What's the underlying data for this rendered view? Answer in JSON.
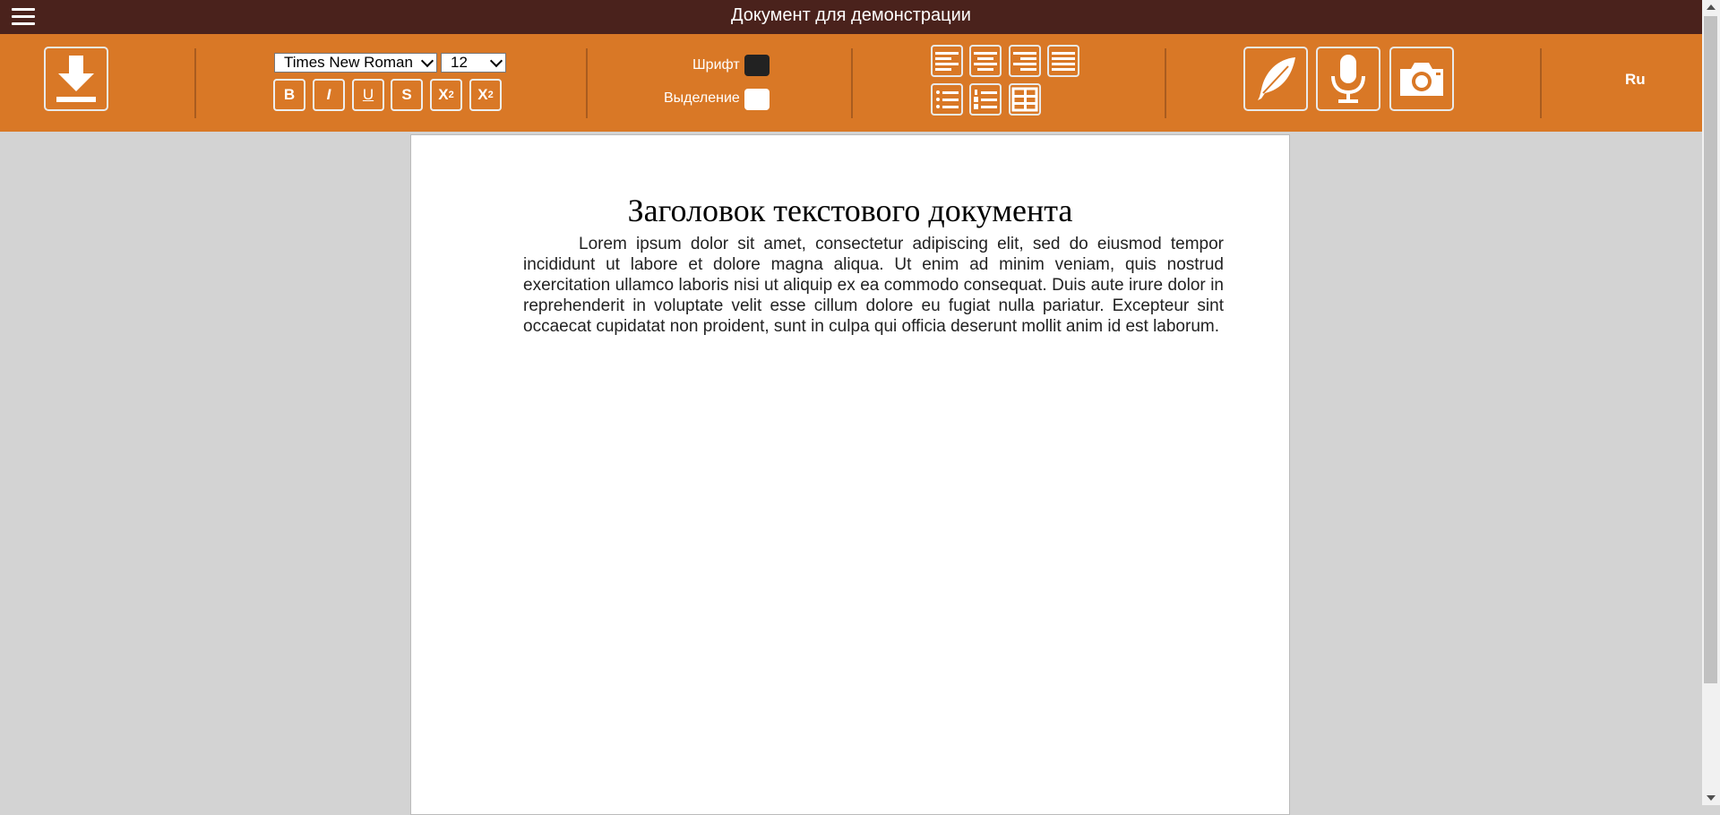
{
  "window": {
    "title": "Документ для демонстрации"
  },
  "toolbar": {
    "font_family": "Times New Roman",
    "font_size": "12",
    "font_color_label": "Шрифт",
    "highlight_label": "Выделение",
    "font_color": "#222222",
    "highlight_color": "#ffffff",
    "bold_label": "B",
    "italic_label": "I",
    "underline_label": "U",
    "strike_label": "S",
    "subscript_label": "X",
    "subscript_mark": "2",
    "superscript_label": "X",
    "superscript_mark": "2",
    "language": "Ru"
  },
  "icons": {
    "menu": "hamburger-icon",
    "download": "download-icon",
    "align_left": "align-left-icon",
    "align_center": "align-center-icon",
    "align_right": "align-right-icon",
    "align_justify": "align-justify-icon",
    "bullet_list": "bullet-list-icon",
    "numbered_list": "numbered-list-icon",
    "table": "table-icon",
    "handwriting": "feather-icon",
    "voice": "microphone-icon",
    "camera": "camera-icon"
  },
  "colors": {
    "titlebar": "#4a221c",
    "toolbar": "#d97826",
    "workspace": "#d3d3d3"
  },
  "document": {
    "heading": "Заголовок текстового документа",
    "paragraph": "Lorem ipsum dolor sit amet, consectetur adipiscing elit, sed do eiusmod tempor incididunt ut labore et dolore magna aliqua. Ut enim ad minim veniam, quis nostrud exercitation ullamco laboris nisi ut aliquip ex ea commodo consequat. Duis aute irure dolor in reprehenderit in voluptate velit esse cillum dolore eu fugiat nulla pariatur. Excepteur sint occaecat cupidatat non proident, sunt in culpa qui officia deserunt mollit anim id est laborum."
  }
}
